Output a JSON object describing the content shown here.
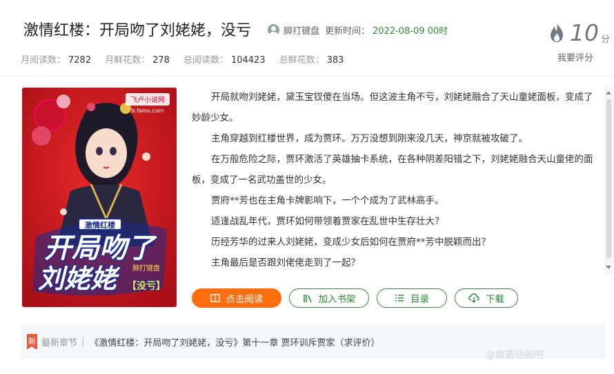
{
  "book": {
    "title": "激情红楼：开局吻了刘姥姥，没亏",
    "author": "脚打键盘",
    "update_label": "更新时间：",
    "update_time": "2022-08-09 00时"
  },
  "stats": [
    {
      "label": "月阅读数：",
      "value": "7282"
    },
    {
      "label": "月鲜花数：",
      "value": "278"
    },
    {
      "label": "总阅读数：",
      "value": "104423"
    },
    {
      "label": "总鲜花数：",
      "value": "383"
    }
  ],
  "rating": {
    "score": "10",
    "unit": "分",
    "action": "我要评分"
  },
  "cover": {
    "logo": "飞卢小说网",
    "logo_url": "b.faloo.com",
    "tag": "激情红楼",
    "title_line1": "开局吻了",
    "title_line2": "刘姥姥",
    "title_suffix": "【没亏】",
    "author": "脚打键盘",
    "colors": {
      "background": "#d81c22",
      "title": "#ffffff",
      "outline": "#1b2c8c",
      "accent": "#ffd84a"
    }
  },
  "description": [
    "开局就吻刘姥姥，黛玉宝钗傻在当场。但这波主角不亏，刘姥姥融合了天山童姥面板，变成了妙龄少女。",
    "主角穿越到红楼世界，成为贾环。万万没想到刚来没几天，神京就被攻破了。",
    "在万般危险之际，贾环激活了英雄抽卡系统，在各种阴差阳错之下，刘姥姥融合天山童佬的面板，变成了一名武功盖世的少女。",
    "贾府**芳也在主角卡牌影响下，一个个成为了武林高手。",
    "适逢战乱年代，贾环如何带领着贾家在乱世中生存壮大？",
    "历经芳华的过来人刘姥姥，变成少女后如何在贾府**芳中脱颖而出？",
    "主角最后是否跟刘佬佬走到了一起？"
  ],
  "buttons": {
    "read": "点击阅读",
    "shelf": "加入书架",
    "toc": "目录",
    "download": "下载"
  },
  "latest": {
    "badge": "新",
    "label": "最新章节",
    "separator": "|",
    "chapter": "《激情红楼：开局吻了刘姥姥，没亏》第十一章 贾环训斥贾家（求评价）"
  },
  "watermark": "@席荟动画吧",
  "colors": {
    "accent_green": "#2e8a3a",
    "accent_orange": "#ff6d0e"
  }
}
